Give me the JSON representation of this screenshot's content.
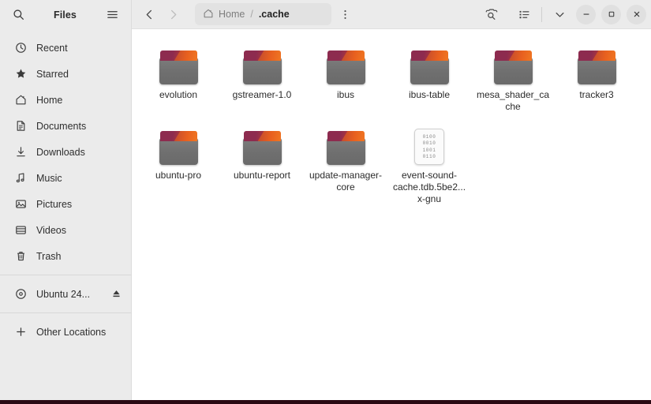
{
  "window": {
    "app_title": "Files"
  },
  "sidebar": {
    "search_icon": "search-icon",
    "menu_icon": "hamburger-menu-icon",
    "items": [
      {
        "label": "Recent",
        "icon": "clock-icon"
      },
      {
        "label": "Starred",
        "icon": "star-icon"
      },
      {
        "label": "Home",
        "icon": "home-icon"
      },
      {
        "label": "Documents",
        "icon": "document-icon"
      },
      {
        "label": "Downloads",
        "icon": "download-icon"
      },
      {
        "label": "Music",
        "icon": "music-note-icon"
      },
      {
        "label": "Pictures",
        "icon": "image-icon"
      },
      {
        "label": "Videos",
        "icon": "video-icon"
      },
      {
        "label": "Trash",
        "icon": "trash-icon"
      }
    ],
    "devices": [
      {
        "label": "Ubuntu 24...",
        "icon": "disc-icon",
        "eject": "eject-icon"
      }
    ],
    "other": {
      "label": "Other Locations",
      "icon": "plus-icon"
    }
  },
  "headerbar": {
    "back_icon": "chevron-left-icon",
    "forward_icon": "chevron-right-icon",
    "breadcrumb": {
      "home_icon": "home-icon",
      "home_label": "Home",
      "separator": "/",
      "current_label": ".cache"
    },
    "path_menu_icon": "vertical-dots-icon",
    "search_icon": "search-icon",
    "view_list_icon": "list-view-icon",
    "view_menu_icon": "chevron-down-icon",
    "minimize_label": "–",
    "maximize_label": "□",
    "close_label": "×"
  },
  "files": [
    {
      "name": "evolution",
      "type": "folder"
    },
    {
      "name": "gstreamer-1.0",
      "type": "folder"
    },
    {
      "name": "ibus",
      "type": "folder"
    },
    {
      "name": "ibus-table",
      "type": "folder"
    },
    {
      "name": "mesa_shader_cache",
      "type": "folder"
    },
    {
      "name": "tracker3",
      "type": "folder"
    },
    {
      "name": "ubuntu-pro",
      "type": "folder"
    },
    {
      "name": "ubuntu-report",
      "type": "folder"
    },
    {
      "name": "update-manager-core",
      "type": "folder"
    },
    {
      "name": "event-sound-cache.tdb.5be2...x-gnu",
      "type": "binary-file",
      "bits": [
        "0100",
        "0010",
        "1001",
        "0110"
      ]
    }
  ],
  "colors": {
    "folder_magenta": "#8d2b4f",
    "folder_orange": "#e8601f",
    "folder_body": "#6f6f6f",
    "sidebar_bg": "#ebebeb",
    "headerbar_bg": "#ebebeb",
    "content_bg": "#ffffff",
    "desktop_strip": "#2c0b16"
  }
}
